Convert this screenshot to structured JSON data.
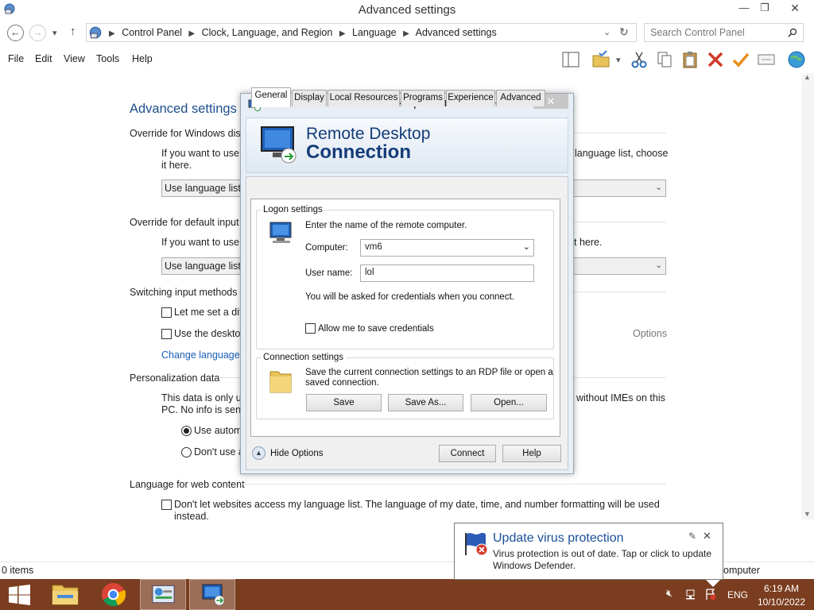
{
  "window": {
    "title": "Advanced settings",
    "minimize_glyph": "—",
    "restore_glyph": "❐",
    "close_glyph": "✕"
  },
  "address": {
    "crumbs": [
      "Control Panel",
      "Clock, Language, and Region",
      "Language",
      "Advanced settings"
    ],
    "search_placeholder": "Search Control Panel"
  },
  "menu": {
    "items": [
      "File",
      "Edit",
      "View",
      "Tools",
      "Help"
    ]
  },
  "toolbar_icons": [
    "layout-pane-icon",
    "folder-check-icon",
    "dropdown-icon",
    "cut-icon",
    "copy-icon",
    "paste-icon",
    "delete-icon",
    "check-icon",
    "properties-icon",
    "globe-icon"
  ],
  "page": {
    "title": "Advanced settings",
    "override_display_heading": "Override for Windows disp",
    "override_display_text_1": "If you want to use",
    "override_display_text_1b": "language list, choose",
    "override_display_text_2": "it here.",
    "override_display_select": "Use language list (",
    "override_input_heading": "Override for default input",
    "override_input_text": "If you want to use",
    "override_input_text_b": "t here.",
    "override_input_select": "Use language list (",
    "switching_heading": "Switching input methods",
    "switch_opt_1": "Let me set a diff",
    "switch_opt_2": "Use the desktop",
    "options_link": "Options",
    "change_language_link": "Change language",
    "personalization_heading": "Personalization data",
    "personalization_text_1": "This data is only us",
    "personalization_text_1b": "without IMEs on this",
    "personalization_text_2": "PC. No info is sent",
    "radio_1": "Use autom",
    "radio_2": "Don't use a",
    "web_heading": "Language for web content",
    "web_checkbox": "Don't let websites access my language list. The language of my date, time, and number formatting will be used",
    "web_checkbox_2": "instead."
  },
  "status": {
    "items_count": "0 items",
    "zone": "omputer"
  },
  "rdp": {
    "title": "Remote Desktop Connection",
    "banner_line1": "Remote Desktop",
    "banner_line2": "Connection",
    "tabs": [
      "General",
      "Display",
      "Local Resources",
      "Programs",
      "Experience",
      "Advanced"
    ],
    "logon_group": "Logon settings",
    "logon_prompt": "Enter the name of the remote computer.",
    "computer_label": "Computer:",
    "computer_value": "vm6",
    "username_label": "User name:",
    "username_value": "lol",
    "credentials_note": "You will be asked for credentials when you connect.",
    "allow_save_label": "Allow me to save credentials",
    "connection_group": "Connection settings",
    "connection_text_1": "Save the current connection settings to an RDP file or open a",
    "connection_text_2": "saved connection.",
    "save_btn": "Save",
    "save_as_btn": "Save As...",
    "open_btn": "Open...",
    "hide_options": "Hide Options",
    "connect_btn": "Connect",
    "help_btn": "Help"
  },
  "toast": {
    "title": "Update virus protection",
    "body_1": "Virus protection is out of date. Tap or click to update",
    "body_2": "Windows Defender."
  },
  "taskbar": {
    "lang": "ENG",
    "time": "6:19 AM",
    "date": "10/10/2022"
  },
  "colors": {
    "taskbar": "#7b3d1f",
    "accent_title": "#1e4e8c",
    "link": "#1a5fb4"
  }
}
